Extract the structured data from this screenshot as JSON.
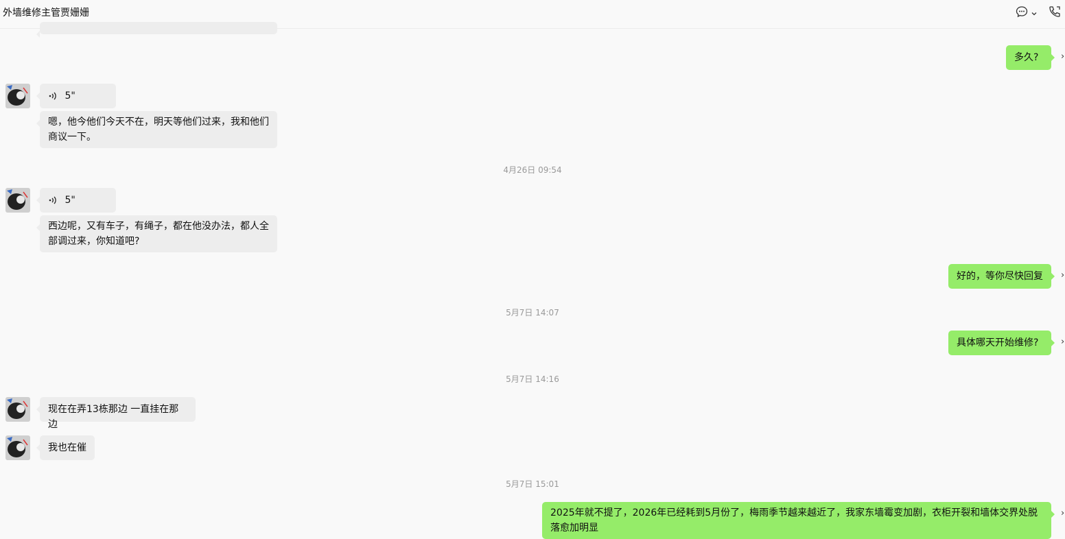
{
  "header": {
    "title": "外墙维修主管贾姗姗",
    "icons": [
      "chat-icon",
      "chevron-down-icon",
      "phone-icon"
    ]
  },
  "messages": {
    "m1": {
      "text": "多久?"
    },
    "m2": {
      "duration": "5\""
    },
    "m3": {
      "text": "嗯，他今他们今天不在，明天等他们过来，我和他们商议一下。"
    },
    "t1": {
      "text": "4月26日 09:54"
    },
    "m4": {
      "duration": "5\""
    },
    "m5": {
      "text": "西边呢，又有车子，有绳子，都在他没办法，都人全部调过来，你知道吧?"
    },
    "m6": {
      "text": "好的，等你尽快回复"
    },
    "t2": {
      "text": "5月7日 14:07"
    },
    "m7": {
      "text": "具体哪天开始维修?"
    },
    "t3": {
      "text": "5月7日 14:16"
    },
    "m8": {
      "text": "现在在弄13栋那边 一直挂在那边"
    },
    "m9": {
      "text": "我也在催"
    },
    "t4": {
      "text": "5月7日 15:01"
    },
    "m10": {
      "text": "2025年就不提了，2026年已经耗到5月份了，梅雨季节越来越近了，我家东墙霉变加剧，衣柜开裂和墙体交界处脱落愈加明显"
    }
  },
  "colors": {
    "outgoing_bubble": "#95ec69",
    "incoming_bubble": "#ededed",
    "background": "#f9f9f9"
  }
}
